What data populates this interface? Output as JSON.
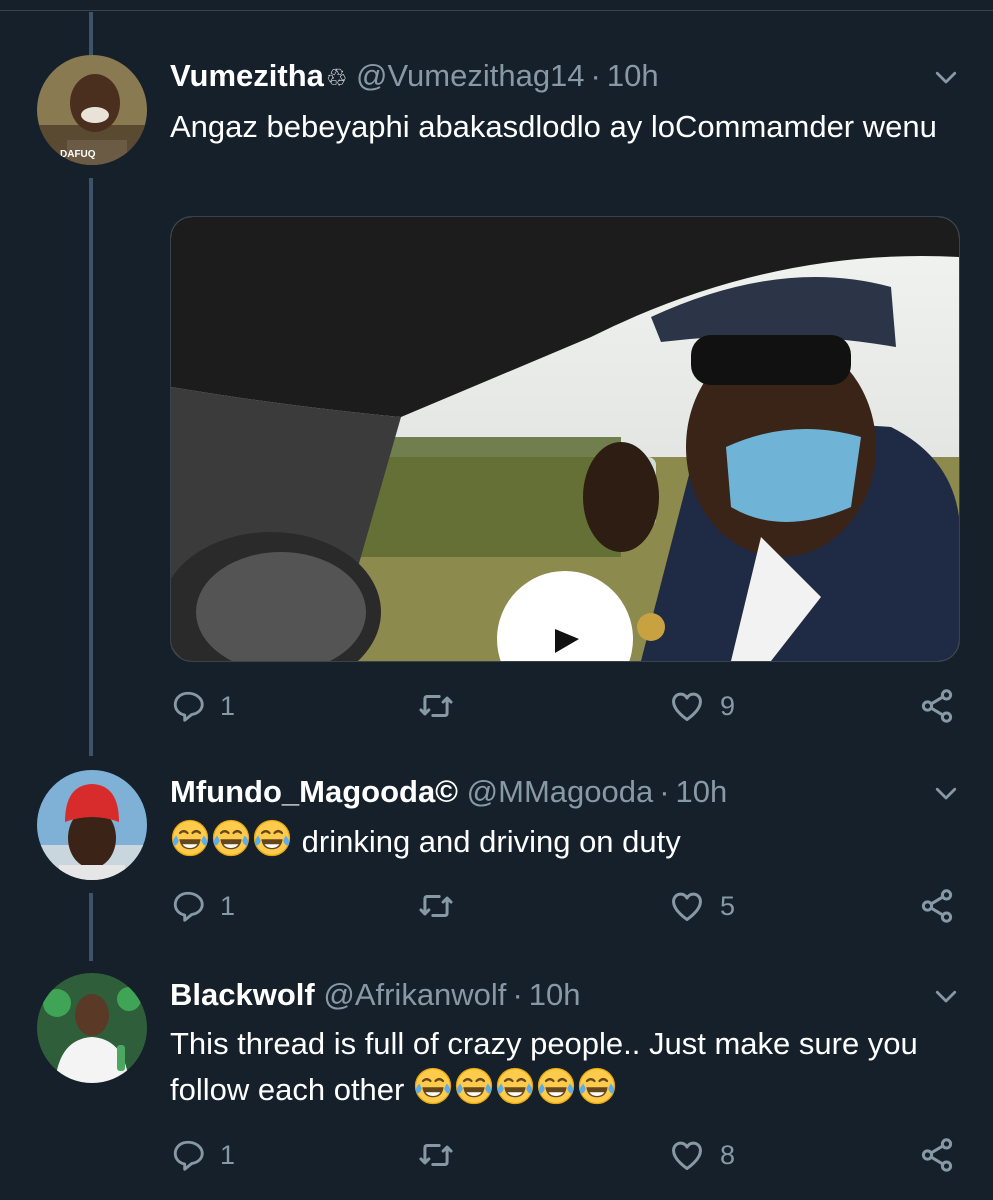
{
  "tweets": [
    {
      "display_name": "Vumezitha",
      "name_badge": "♲",
      "handle": "@Vumezithag14",
      "dot": "·",
      "time": "10h",
      "text": "Angaz bebeyaphi abakasdlodlo ay loCommamder wenu",
      "avatar_caption": "DAFUQ",
      "has_video": true,
      "replies": "1",
      "retweets": "",
      "likes": "9"
    },
    {
      "display_name": "Mfundo_Magooda©",
      "handle": "@MMagooda",
      "dot": "·",
      "time": "10h",
      "emoji_lead": [
        "face-with-tears-of-joy",
        "face-with-tears-of-joy",
        "face-with-tears-of-joy"
      ],
      "text": "drinking and driving on duty",
      "replies": "1",
      "retweets": "",
      "likes": "5"
    },
    {
      "display_name": "Blackwolf",
      "handle": "@Afrikanwolf",
      "dot": "·",
      "time": "10h",
      "text": "This thread is full of crazy people.. Just make sure you follow each other",
      "emoji_trail": [
        "face-with-tears-of-joy",
        "face-with-tears-of-joy",
        "face-with-tears-of-joy",
        "face-with-tears-of-joy",
        "face-with-tears-of-joy"
      ],
      "replies": "1",
      "retweets": "",
      "likes": "8"
    }
  ],
  "icons": {
    "reply": "reply-icon",
    "retweet": "retweet-icon",
    "like": "heart-icon",
    "share": "share-icon",
    "menu": "chevron-down-icon",
    "play": "play-icon"
  },
  "colors": {
    "background": "#15202b",
    "secondary_text": "#8899a6",
    "thread_line": "#3d5466",
    "emoji": "#ffcb4c"
  }
}
